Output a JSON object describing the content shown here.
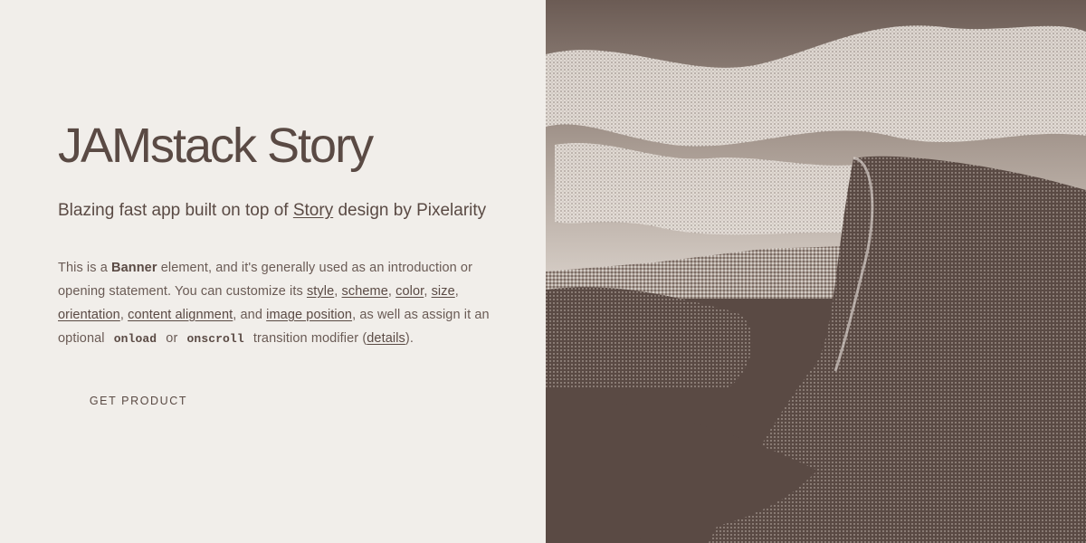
{
  "banner": {
    "title": "JAMstack Story",
    "subtitle_before": "Blazing fast app built on top of ",
    "subtitle_link": "Story",
    "subtitle_after": " design by Pixelarity",
    "desc": {
      "t1": "This is a ",
      "bold": "Banner",
      "t2": " element, and it's generally used as an introduction or opening statement. You can customize its ",
      "link_style": "style",
      "t3": ", ",
      "link_scheme": "scheme",
      "t4": ", ",
      "link_color": "color",
      "t5": ", ",
      "link_size": "size",
      "t6": ", ",
      "link_orientation": "orientation",
      "t7": ", ",
      "link_content_alignment": "content alignment",
      "t8": ", and ",
      "link_image_position": "image position",
      "t9": ", as well as assign it an optional ",
      "code_onload": "onload",
      "t10": " or ",
      "code_onscroll": "onscroll",
      "t11": " transition modifier (",
      "link_details": "details",
      "t12": ")."
    },
    "cta_label": "GET PRODUCT"
  },
  "colors": {
    "background": "#f1eeea",
    "text": "#5a4a44",
    "image_dark": "#5a4a44",
    "image_light": "#f1eeea"
  },
  "image": {
    "description_icon": "landscape-image"
  }
}
